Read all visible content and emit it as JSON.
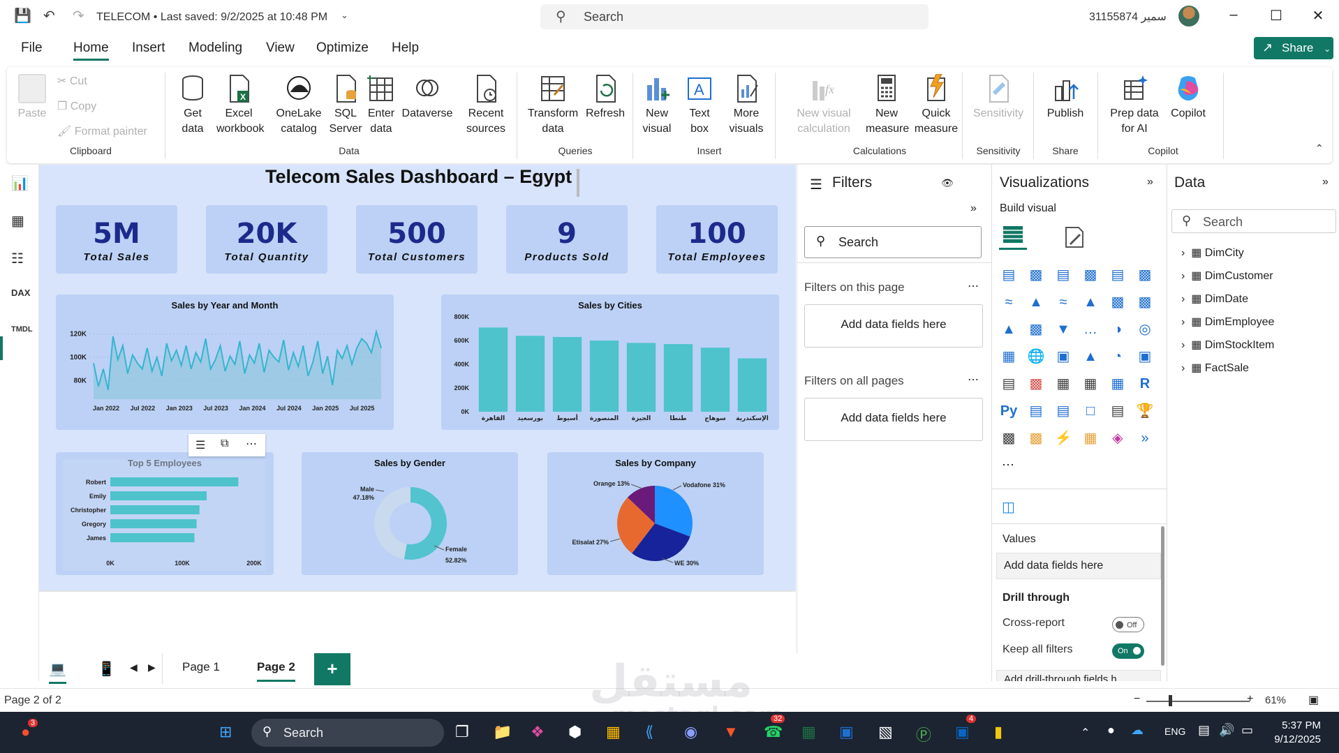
{
  "titlebar": {
    "doc_title": "TELECOM • Last saved: 9/2/2025 at 10:48 PM",
    "search_placeholder": "Search",
    "user": "31155874 سمير"
  },
  "menu": [
    "File",
    "Home",
    "Insert",
    "Modeling",
    "View",
    "Optimize",
    "Help"
  ],
  "share_label": "Share",
  "ribbon": {
    "clipboard": {
      "paste": "Paste",
      "cut": "Cut",
      "copy": "Copy",
      "format_painter": "Format painter",
      "label": "Clipboard"
    },
    "data": {
      "get_data": "Get data",
      "excel": "Excel workbook",
      "onelake": "OneLake catalog",
      "sql": "SQL Server",
      "enter": "Enter data",
      "dataverse": "Dataverse",
      "recent": "Recent sources",
      "label": "Data"
    },
    "queries": {
      "transform": "Transform data",
      "refresh": "Refresh",
      "label": "Queries"
    },
    "insert": {
      "new_visual": "New visual",
      "text_box": "Text box",
      "more_visuals": "More visuals",
      "label": "Insert"
    },
    "calculations": {
      "new_visual_calc": "New visual calculation",
      "new_measure": "New measure",
      "quick_measure": "Quick measure",
      "label": "Calculations"
    },
    "sensitivity": {
      "btn": "Sensitivity",
      "label": "Sensitivity"
    },
    "share": {
      "publish": "Publish",
      "label": "Share"
    },
    "copilot": {
      "prep": "Prep data for AI",
      "copilot": "Copilot",
      "label": "Copilot"
    }
  },
  "dashboard": {
    "title": "Telecom Sales Dashboard – Egypt",
    "kpis": [
      {
        "value": "5M",
        "label": "Total Sales"
      },
      {
        "value": "20K",
        "label": "Total Quantity"
      },
      {
        "value": "500",
        "label": "Total Customers"
      },
      {
        "value": "9",
        "label": "Products Sold"
      },
      {
        "value": "100",
        "label": "Total Employees"
      }
    ]
  },
  "chart_data": [
    {
      "type": "area",
      "title": "Sales by Year and Month",
      "x_ticks": [
        "Jan 2022",
        "Jul 2022",
        "Jan 2023",
        "Jul 2023",
        "Jan 2024",
        "Jul 2024",
        "Jan 2025",
        "Jul 2025"
      ],
      "y_ticks": [
        "80K",
        "100K",
        "120K"
      ],
      "ylim": [
        70000,
        130000
      ],
      "values": [
        95000,
        75000,
        90000,
        72000,
        118000,
        98000,
        110000,
        86000,
        102000,
        95000,
        90000,
        108000,
        88000,
        100000,
        84000,
        112000,
        97000,
        106000,
        93000,
        110000,
        90000,
        104000,
        96000,
        116000,
        90000,
        98000,
        110000,
        88000,
        101000,
        94000,
        114000,
        86000,
        102000,
        95000,
        112000,
        87000,
        106000,
        100000,
        96000,
        115000,
        89000,
        104000,
        92000,
        110000,
        84000,
        96000,
        114000,
        86000,
        101000,
        76000,
        106000,
        99000,
        110000,
        94000,
        108000,
        116000,
        112000,
        104000,
        122000,
        108000
      ]
    },
    {
      "type": "bar",
      "title": "Sales by Cities",
      "categories": [
        "القاهرة",
        "بورسعيد",
        "أسيوط",
        "المنصورة",
        "الجيزة",
        "طنطا",
        "سوهاج",
        "الإسكندرية"
      ],
      "values": [
        710000,
        640000,
        630000,
        600000,
        580000,
        570000,
        540000,
        450000
      ],
      "y_ticks": [
        "0K",
        "200K",
        "400K",
        "600K",
        "800K"
      ],
      "ylim": [
        0,
        800000
      ]
    },
    {
      "type": "bar",
      "orientation": "horizontal",
      "title": "Top 5 Employees",
      "categories": [
        "Robert",
        "Emily",
        "Christopher",
        "Gregory",
        "James"
      ],
      "values": [
        178000,
        134000,
        124000,
        120000,
        117000
      ],
      "x_ticks": [
        "0K",
        "100K",
        "200K"
      ],
      "xlim": [
        0,
        200000
      ]
    },
    {
      "type": "pie",
      "variant": "donut",
      "title": "Sales by Gender",
      "slices": [
        {
          "name": "Male",
          "value": 47.18,
          "label": "Male\n47.18%",
          "color": "#c9d9ee"
        },
        {
          "name": "Female",
          "value": 52.82,
          "label": "Female\n52.82%",
          "color": "#52c3cf"
        }
      ]
    },
    {
      "type": "pie",
      "title": "Sales by Company",
      "slices": [
        {
          "name": "Vodafone",
          "value": 31,
          "label": "Vodafone 31%",
          "color": "#1e90ff"
        },
        {
          "name": "WE",
          "value": 30,
          "label": "WE 30%",
          "color": "#16239a"
        },
        {
          "name": "Etisalat",
          "value": 27,
          "label": "Etisalat 27%",
          "color": "#e8692f"
        },
        {
          "name": "Orange",
          "value": 13,
          "label": "Orange 13%",
          "color": "#6a1b7a"
        }
      ]
    }
  ],
  "filters": {
    "title": "Filters",
    "search": "Search",
    "on_page": "Filters on this page",
    "on_all": "Filters on all pages",
    "add": "Add data fields here"
  },
  "viz": {
    "title": "Visualizations",
    "build": "Build visual",
    "values": "Values",
    "add": "Add data fields here",
    "drill": "Drill through",
    "cross": "Cross-report",
    "cross_state": "Off",
    "keep": "Keep all filters",
    "keep_state": "On",
    "add_drill": "Add drill-through fields h"
  },
  "data_pane": {
    "title": "Data",
    "search": "Search",
    "tables": [
      "DimCity",
      "DimCustomer",
      "DimDate",
      "DimEmployee",
      "DimStockItem",
      "FactSale"
    ]
  },
  "pages": {
    "page1": "Page 1",
    "page2": "Page 2",
    "add": "+"
  },
  "status": {
    "left": "Page 2 of 2",
    "zoom": "61%"
  },
  "taskbar": {
    "search": "Search",
    "lang": "ENG",
    "time": "5:37 PM",
    "date": "9/12/2025",
    "badges": {
      "a": "3",
      "b": "32",
      "c": "4"
    }
  },
  "watermark": {
    "ar": "مستقل",
    "en": "mostaql.com"
  }
}
